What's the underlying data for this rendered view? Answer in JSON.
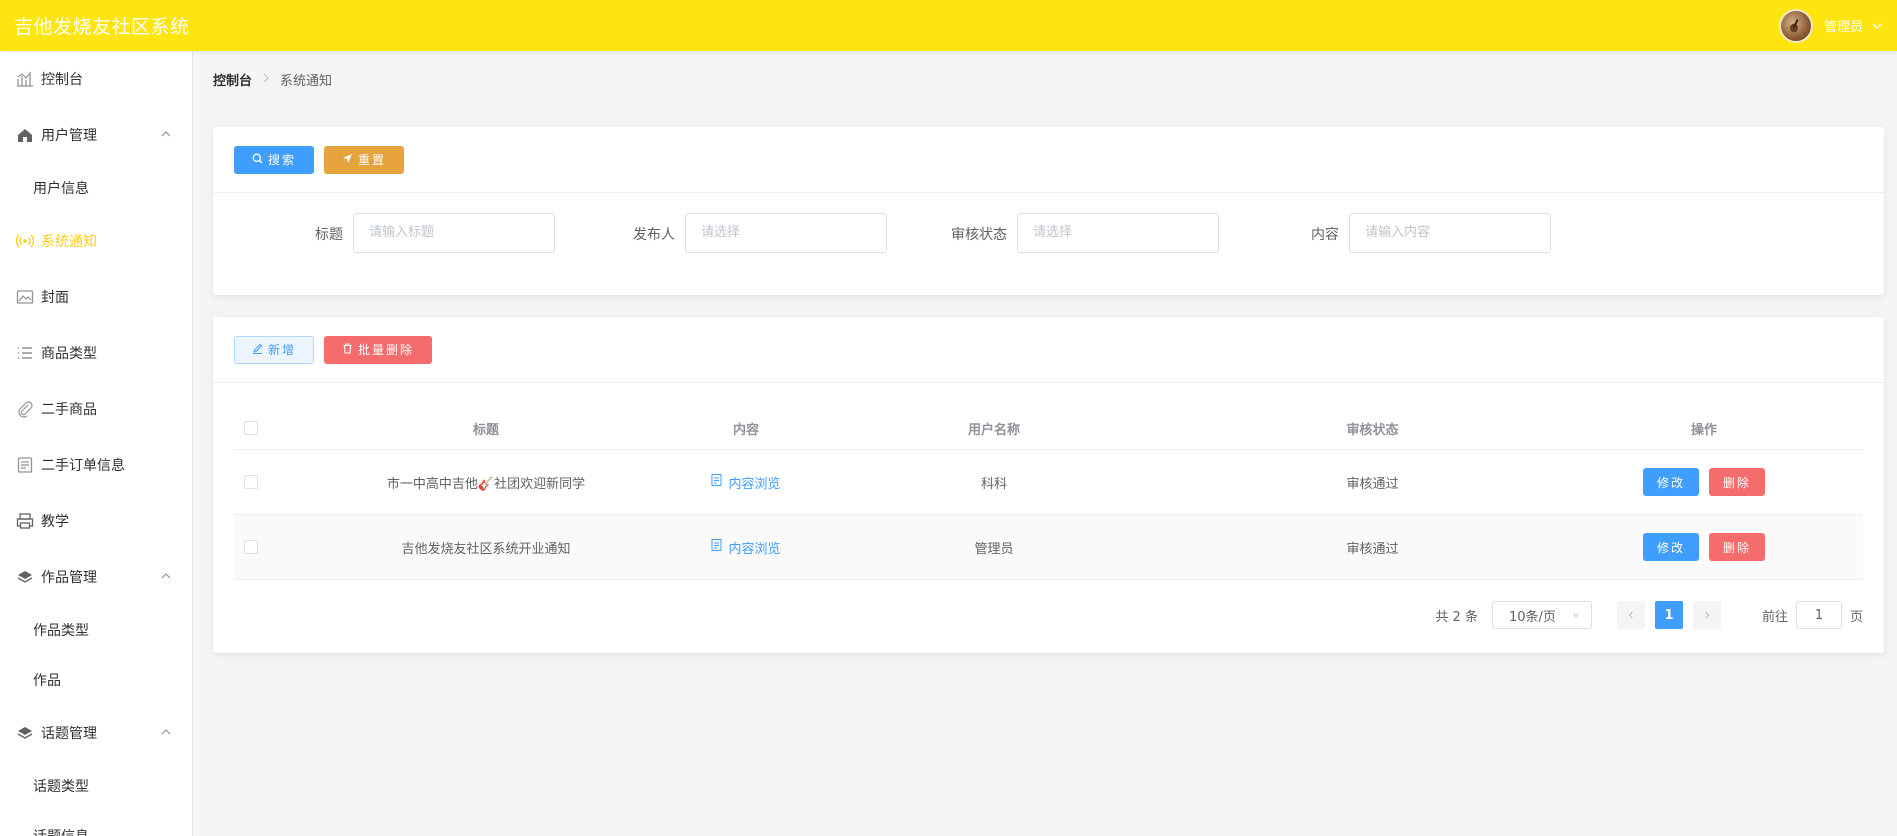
{
  "header": {
    "title": "吉他发烧友社区系统",
    "user_label": "管理员"
  },
  "sidebar": {
    "items": [
      {
        "label": "控制台",
        "icon": "chart-icon"
      },
      {
        "label": "用户管理",
        "icon": "home-icon"
      },
      {
        "label": "用户信息"
      },
      {
        "label": "系统通知",
        "icon": "broadcast-icon"
      },
      {
        "label": "封面",
        "icon": "image-icon"
      },
      {
        "label": "商品类型",
        "icon": "list-icon"
      },
      {
        "label": "二手商品",
        "icon": "paperclip-icon"
      },
      {
        "label": "二手订单信息",
        "icon": "document-icon"
      },
      {
        "label": "教学",
        "icon": "printer-icon"
      },
      {
        "label": "作品管理",
        "icon": "layers-icon"
      },
      {
        "label": "作品类型"
      },
      {
        "label": "作品"
      },
      {
        "label": "话题管理",
        "icon": "layers-icon"
      },
      {
        "label": "话题类型"
      },
      {
        "label": "话题信息"
      }
    ]
  },
  "breadcrumb": {
    "root": "控制台",
    "current": "系统通知"
  },
  "search": {
    "search_label": "搜索",
    "reset_label": "重置",
    "fields": [
      {
        "label": "标题",
        "placeholder": "请输入标题"
      },
      {
        "label": "发布人",
        "placeholder": "请选择"
      },
      {
        "label": "审核状态",
        "placeholder": "请选择"
      },
      {
        "label": "内容",
        "placeholder": "请输入内容"
      }
    ]
  },
  "toolbar": {
    "add_label": "新增",
    "batch_delete_label": "批量删除"
  },
  "table": {
    "headers": [
      "标题",
      "内容",
      "用户名称",
      "审核状态",
      "操作"
    ],
    "rows": [
      {
        "title": "市一中高中吉他🎸社团欢迎新同学",
        "content_link": "内容浏览",
        "user": "科科",
        "status": "审核通过"
      },
      {
        "title": "吉他发烧友社区系统开业通知",
        "content_link": "内容浏览",
        "user": "管理员",
        "status": "审核通过"
      }
    ],
    "edit_label": "修改",
    "delete_label": "删除"
  },
  "pagination": {
    "total_text": "共 2 条",
    "page_size": "10条/页",
    "current_page": "1",
    "goto_prefix": "前往",
    "goto_value": "1",
    "goto_suffix": "页"
  },
  "colors": {
    "header_bg": "#ffe50f",
    "active_menu": "#ffce1a",
    "primary": "#409eff",
    "warning": "#e6a23c",
    "danger": "#f56c6c"
  }
}
